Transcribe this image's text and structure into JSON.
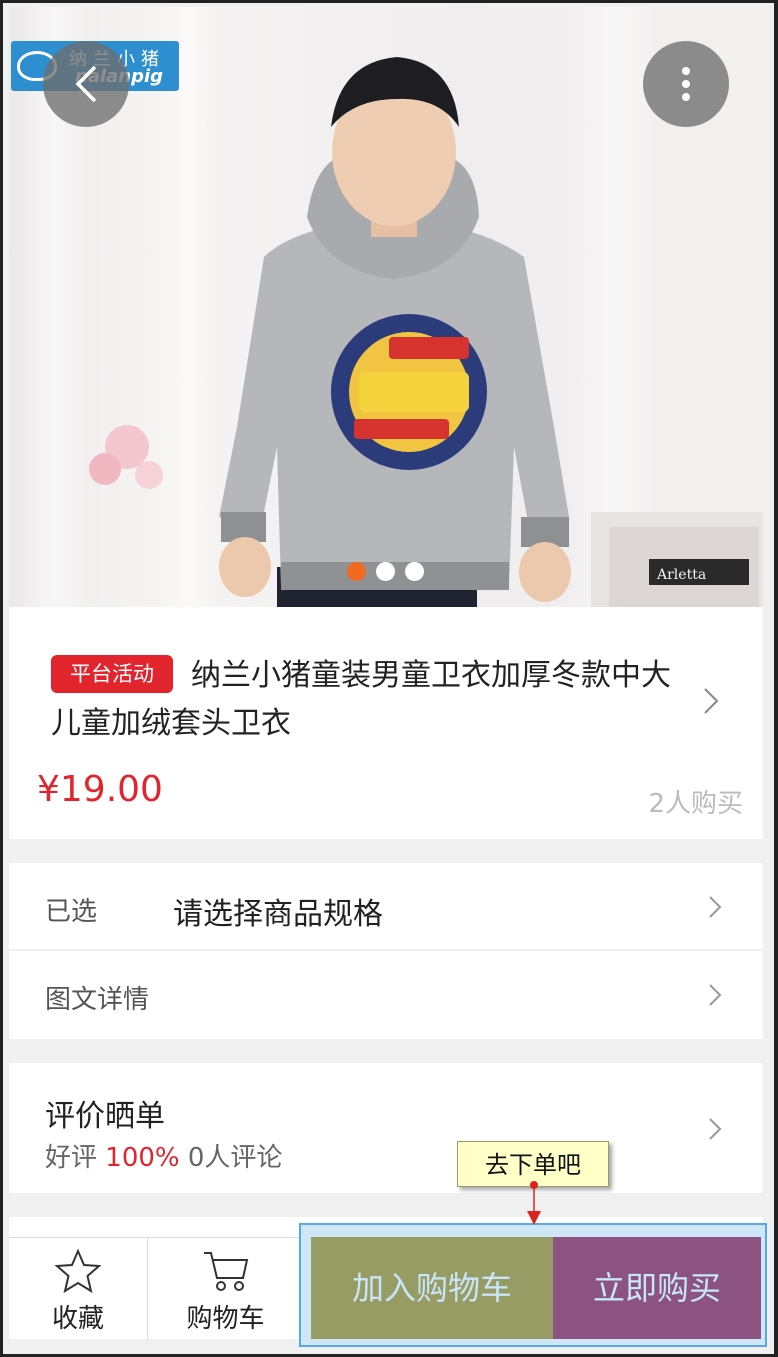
{
  "brand": {
    "logo_cn": "纳兰小猪",
    "logo_en": "nalanpig"
  },
  "hero": {
    "carousel_active_index": 0,
    "carousel_count": 3
  },
  "product": {
    "badge": "平台活动",
    "title": "纳兰小猪童装男童卫衣加厚冬款中大儿童加绒套头卫衣",
    "price": "¥19.00",
    "buyers": "2人购买"
  },
  "spec": {
    "label": "已选",
    "value": "请选择商品规格"
  },
  "detail": {
    "label": "图文详情"
  },
  "review": {
    "title": "评价晒单",
    "good_label": "好评",
    "good_rate": "100%",
    "count": "0人评论"
  },
  "bottom_bar": {
    "favorite_label": "收藏",
    "cart_label": "购物车",
    "add_to_cart_label": "加入购物车",
    "buy_now_label": "立即购买"
  },
  "annotation": {
    "callout": "去下单吧"
  },
  "colors": {
    "accent_red": "#e2252d",
    "carousel_active": "#f06a1f",
    "add_cart_bg": "#979c64",
    "buy_now_bg": "#8b5282"
  }
}
